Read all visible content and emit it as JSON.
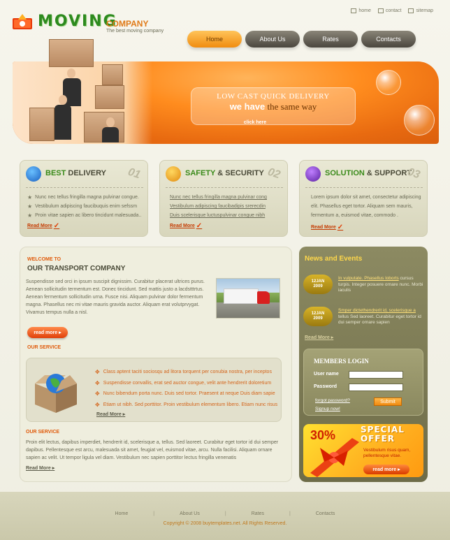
{
  "header": {
    "logo_text": "MOVING",
    "logo_company": "COMPANY",
    "tagline": "The best  moving company",
    "top_links": [
      "home",
      "contact",
      "sitemap"
    ],
    "nav": [
      "Home",
      "About Us",
      "Rates",
      "Contacts"
    ],
    "nav_active": "Home"
  },
  "banner": {
    "line1": "LOW CAST QUICK DELIVERY",
    "line2_bold": "we have",
    "line2_rest": " the same way",
    "cta": "click here"
  },
  "features": [
    {
      "title_accent": "BEST",
      "title_rest": " DELIVERY",
      "number": "01",
      "lines": [
        "Nunc nec tellus fringilla magna pulvinar congue.",
        "Vestibulum adipiscing faucibuquis enim sefssm",
        "Proin vitae sapien ac libero tincidunt malesuada.."
      ],
      "read_more": "Read More"
    },
    {
      "title_accent": "SAFETY",
      "title_rest": " & SECURITY",
      "number": "02",
      "lines": [
        "Nunc nec tellus fringilla magna pulvinar cong",
        "Vestibulum adipiscing faucibadipis srerecdin",
        "Duis scelerisque luctuspulvinar congue nibh"
      ],
      "read_more": "Read More"
    },
    {
      "title_accent": "SOLUTION",
      "title_rest": " & SUPPORT",
      "number": "03",
      "text": "Lorem ipsum dolor sit amet, consectetur adipiscing elit. Phasellus eget tortor. Aliquam sem mauris, fermentum a, euismod vitae, commodo .",
      "read_more": "Read More"
    }
  ],
  "main": {
    "welcome": "WELCOME TO",
    "company_title": "OUR TRANSPORT COMPANY",
    "paragraph": "Suspendisse sed orci in ipsum suscipit dignissim. Curabitur placerat ultrices purus. Aenean sollicitudin termentum est. Donec tincidunt. Sed mattis justo a lacdstttrtus. Aenean fermentum sollicitudin urna. Fusce nisi. Aliquam pulvinar dolor fermentum magna. Phasellus nec mi vitae mauris gravida auctor. Aliquam erat volutprvygat. Vivamus tempus nulla a nisl.",
    "read_more_btn": "read more",
    "service1_title": "OUR SERVICE",
    "service_list": [
      "Class aptent taciti sociosqu ad litora torquent per conubia nostra, per inceptos",
      "Suspendisse convallis, erat sed auctor congue, velit ante hendrerit doloretium",
      "Nunc bibendum porta nunc. Duis sed tortor. Praesent at neque Duis diam sapie",
      "Etiam ut nibh. Sed porttitor. Proin vestibulum elementum libero. Etiam nunc risus"
    ],
    "service_read_more": "Read More",
    "service2_title": "OUR SERVICE",
    "service2_text": "Proin elit lectus, dapibus imperdiet, hendrerit id, scelerisque a, tellus. Sed laoreet. Curabitur eget tortor id dui semper dapibus. Pellentesque est arcu, malesuada sit amet, feugiat vel, euismod vitae, arcu. Nulla facilisi. Aliquam ornare sapien ac velit. Ut tempor ligula vel diam. Vestibulum nec sapien porttitor lectus fringilla venenatis",
    "service2_read_more": "Read More"
  },
  "sidebar": {
    "news_title": "News and Events",
    "news": [
      {
        "date_day": "12JAN",
        "date_year": "2009",
        "link": "In vulputate. Phasellus loborts",
        "text": " cursus turpis. Integer posuere ornare nunc. Morbi iaculis"
      },
      {
        "date_day": "12JAN",
        "date_year": "2009",
        "link": "Smper dictethendrerit id, scelerisque a",
        "text": " tellus Sed laoreet. Curabitur eget tortor id dui semper ornare sapien"
      }
    ],
    "news_read_more": "Read More",
    "login": {
      "title": "MEMBERS LOGIN",
      "user_label": "User name",
      "pass_label": "Password",
      "forgot": "forgot password?",
      "signup": "Signup now!",
      "submit": "Submit"
    },
    "special": {
      "percent": "30%",
      "title1": "SPECIAL",
      "title2": "OFFER",
      "text": "Vestibulum risus quam, pellentesque vitae.",
      "btn": "read more"
    }
  },
  "footer": {
    "nav": [
      "Home",
      "About Us",
      "Rates",
      "Contacts"
    ],
    "copyright": "Copyright © 2008 buytemplates.net. All Rights Reserved."
  },
  "colors": {
    "accent_orange": "#f08c10",
    "green_brand": "#2d8a1e",
    "sidebar_olive": "#7c7a54",
    "link_red": "#c43a00"
  }
}
